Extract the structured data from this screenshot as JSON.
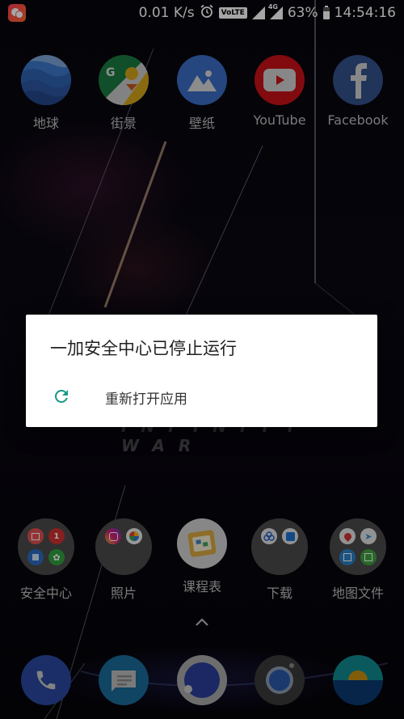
{
  "status_bar": {
    "notification_app_icon": "chat-bubbles-icon",
    "network_speed": "0.01 K/s",
    "alarm_icon": "alarm-clock-icon",
    "volte_label": "VoLTE",
    "network_type": "4G",
    "battery_percent": "63%",
    "battery_level": 0.63,
    "time": "14:54:16"
  },
  "home_row1": [
    {
      "label": "地球",
      "icon": "google-earth-icon"
    },
    {
      "label": "街景",
      "icon": "street-view-icon"
    },
    {
      "label": "壁纸",
      "icon": "wallpapers-icon"
    },
    {
      "label": "YouTube",
      "icon": "youtube-icon"
    },
    {
      "label": "Facebook",
      "icon": "facebook-icon"
    }
  ],
  "wallpaper_text": "INFINITY WAR",
  "dialog": {
    "title": "一加安全中心已停止运行",
    "action_label": "重新打开应用",
    "action_icon": "refresh-icon",
    "accent_color": "#1a9a8a"
  },
  "home_row2": [
    {
      "label": "安全中心",
      "type": "folder"
    },
    {
      "label": "照片",
      "type": "folder"
    },
    {
      "label": "课程表",
      "type": "app"
    },
    {
      "label": "下载",
      "type": "folder"
    },
    {
      "label": "地图文件",
      "type": "folder"
    }
  ],
  "app_drawer_hint_icon": "chevron-up-icon",
  "dock": [
    {
      "name": "phone",
      "icon": "phone-icon"
    },
    {
      "name": "messages",
      "icon": "messages-icon"
    },
    {
      "name": "browser",
      "icon": "browser-icon"
    },
    {
      "name": "camera",
      "icon": "camera-icon"
    },
    {
      "name": "gallery",
      "icon": "gallery-icon"
    }
  ]
}
